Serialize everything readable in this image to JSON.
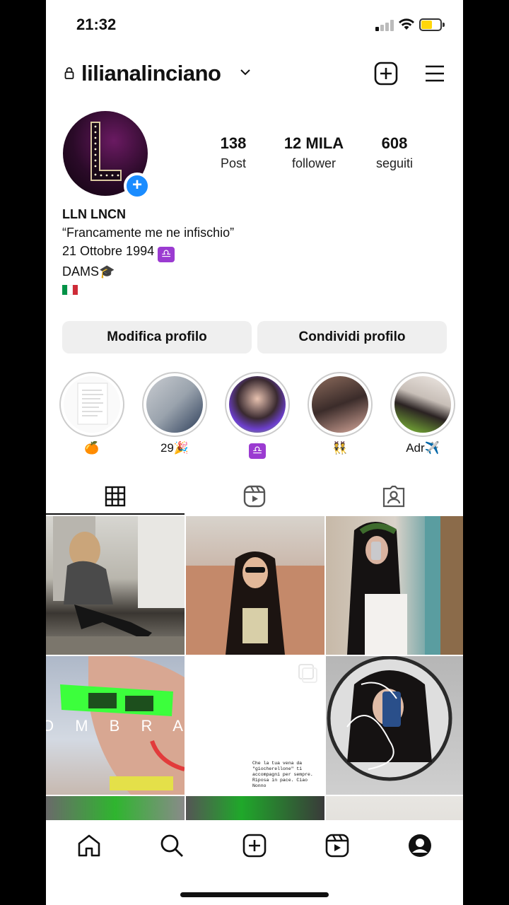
{
  "status": {
    "time": "21:32",
    "battery_color": "#ffd60a"
  },
  "header": {
    "username": "lilianalinciano"
  },
  "stats": [
    {
      "value": "138",
      "label": "Post"
    },
    {
      "value": "12 MILA",
      "label": "follower"
    },
    {
      "value": "608",
      "label": "seguiti"
    }
  ],
  "bio": {
    "name": "LLN  LNCN",
    "quote": "“Francamente me ne infischio”",
    "birthday": "21 Ottobre 1994",
    "zodiac": "♎",
    "school": "DAMS🎓",
    "flag": "italy-flag"
  },
  "buttons": {
    "edit": "Modifica profilo",
    "share": "Condividi profilo"
  },
  "highlights": [
    {
      "caption": "🍊"
    },
    {
      "caption": "29🎉"
    },
    {
      "caption": "♎"
    },
    {
      "caption": "👯"
    },
    {
      "caption": "Adr✈️"
    }
  ],
  "grid_overlays": {
    "ombra_text": "O M B R A",
    "quote_text": "Che la tua vena da \"giocherellone\" ti accompagni per sempre. Riposa in pace. Ciao Nonno"
  },
  "accent_color": "#1a8cff"
}
